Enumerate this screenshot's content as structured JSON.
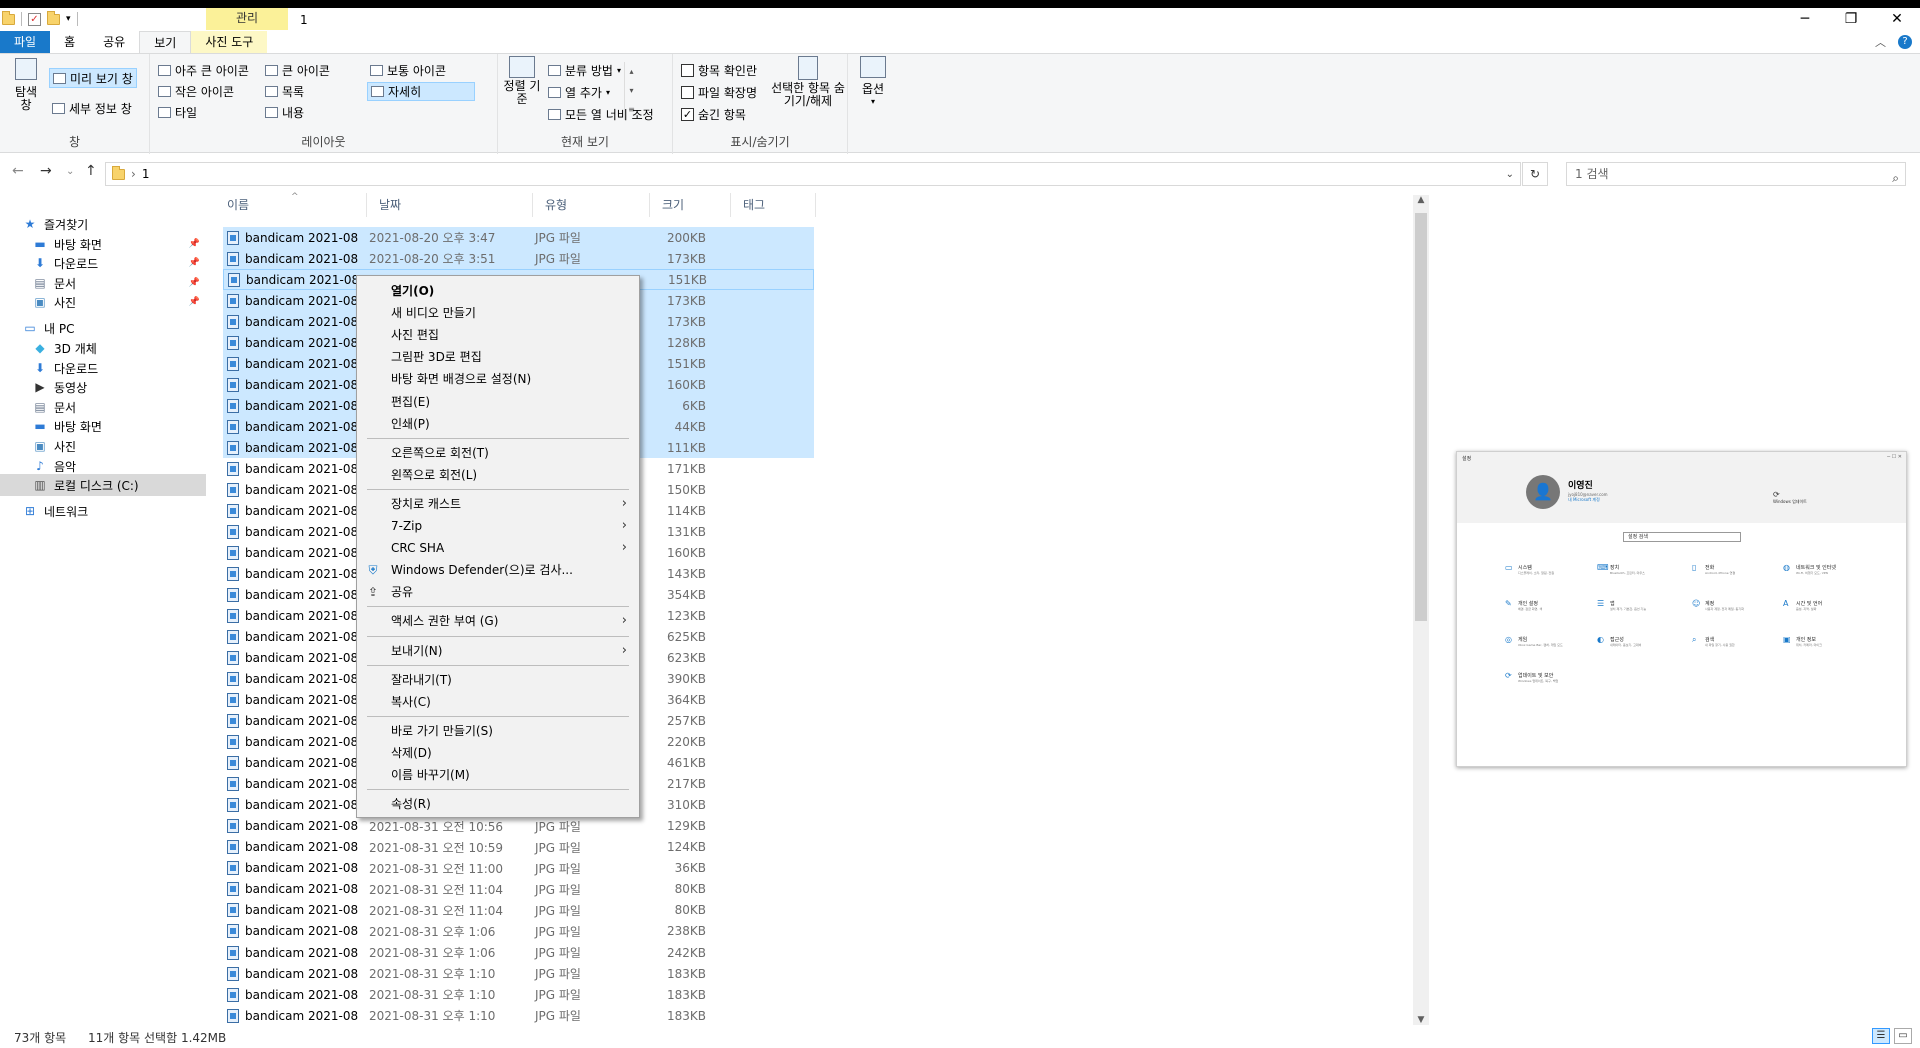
{
  "window": {
    "title": "1",
    "context_tab_header": "관리"
  },
  "ribbon_tabs": [
    {
      "label": "파일"
    },
    {
      "label": "홈"
    },
    {
      "label": "공유"
    },
    {
      "label": "보기"
    },
    {
      "label": "사진 도구"
    }
  ],
  "ribbon": {
    "pane_group": {
      "nav_pane": "탐색 창",
      "preview_pane": "미리 보기 창",
      "details_pane": "세부 정보 창",
      "label": "창"
    },
    "layout_group": {
      "items": [
        "아주 큰 아이콘",
        "큰 아이콘",
        "보통 아이콘",
        "작은 아이콘",
        "목록",
        "자세히",
        "타일",
        "내용"
      ],
      "label": "레이아웃"
    },
    "current_view_group": {
      "sort_by": "정렬 기준",
      "group_by": "분류 방법",
      "add_columns": "열 추가",
      "size_all_columns": "모든 열 너비 조정",
      "label": "현재 보기"
    },
    "show_hide_group": {
      "item_check_boxes": "항목 확인란",
      "file_extensions": "파일 확장명",
      "hidden_items": "숨긴 항목",
      "hide_selected": "선택한 항목 숨기기/해제",
      "label": "표시/숨기기",
      "checks": [
        false,
        false,
        true
      ]
    },
    "options": "옵션"
  },
  "address": {
    "path": "1",
    "search_placeholder": "1 검색"
  },
  "nav_pane": [
    {
      "label": "즐겨찾기",
      "icon": "star-icon",
      "level": 0
    },
    {
      "label": "바탕 화면",
      "icon": "desktop-icon",
      "level": 1,
      "pinned": true
    },
    {
      "label": "다운로드",
      "icon": "download-icon",
      "level": 1,
      "pinned": true
    },
    {
      "label": "문서",
      "icon": "document-icon",
      "level": 1,
      "pinned": true
    },
    {
      "label": "사진",
      "icon": "pictures-icon",
      "level": 1,
      "pinned": true
    },
    {
      "label": "내 PC",
      "icon": "pc-icon",
      "level": 0
    },
    {
      "label": "3D 개체",
      "icon": "cube-icon",
      "level": 1
    },
    {
      "label": "다운로드",
      "icon": "download-icon",
      "level": 1
    },
    {
      "label": "동영상",
      "icon": "video-icon",
      "level": 1
    },
    {
      "label": "문서",
      "icon": "document-icon",
      "level": 1
    },
    {
      "label": "바탕 화면",
      "icon": "desktop-icon",
      "level": 1
    },
    {
      "label": "사진",
      "icon": "pictures-icon",
      "level": 1
    },
    {
      "label": "음악",
      "icon": "music-icon",
      "level": 1
    },
    {
      "label": "로컬 디스크 (C:)",
      "icon": "drive-icon",
      "level": 1,
      "selected": true
    },
    {
      "label": "네트워크",
      "icon": "network-icon",
      "level": 0
    }
  ],
  "columns": {
    "name": "이름",
    "date": "날짜",
    "type": "유형",
    "size": "크기",
    "tags": "태그"
  },
  "files": [
    {
      "name": "bandicam 2021-08...",
      "date": "2021-08-20 오후 3:47",
      "type": "JPG 파일",
      "size": "200KB",
      "selected": true
    },
    {
      "name": "bandicam 2021-08...",
      "date": "2021-08-20 오후 3:51",
      "type": "JPG 파일",
      "size": "173KB",
      "selected": true
    },
    {
      "name": "bandicam 2021-08...",
      "date": "",
      "type": "",
      "size": "151KB",
      "selected": true,
      "focus": true
    },
    {
      "name": "bandicam 2021-08...",
      "date": "",
      "type": "",
      "size": "173KB",
      "selected": true
    },
    {
      "name": "bandicam 2021-08...",
      "date": "",
      "type": "",
      "size": "173KB",
      "selected": true
    },
    {
      "name": "bandicam 2021-08...",
      "date": "",
      "type": "",
      "size": "128KB",
      "selected": true
    },
    {
      "name": "bandicam 2021-08...",
      "date": "",
      "type": "",
      "size": "151KB",
      "selected": true
    },
    {
      "name": "bandicam 2021-08...",
      "date": "",
      "type": "",
      "size": "160KB",
      "selected": true
    },
    {
      "name": "bandicam 2021-08...",
      "date": "",
      "type": "",
      "size": "6KB",
      "selected": true
    },
    {
      "name": "bandicam 2021-08...",
      "date": "",
      "type": "",
      "size": "44KB",
      "selected": true
    },
    {
      "name": "bandicam 2021-08...",
      "date": "",
      "type": "",
      "size": "111KB",
      "selected": true
    },
    {
      "name": "bandicam 2021-08...",
      "date": "",
      "type": "",
      "size": "171KB"
    },
    {
      "name": "bandicam 2021-08...",
      "date": "",
      "type": "",
      "size": "150KB"
    },
    {
      "name": "bandicam 2021-08...",
      "date": "",
      "type": "",
      "size": "114KB"
    },
    {
      "name": "bandicam 2021-08...",
      "date": "",
      "type": "",
      "size": "131KB"
    },
    {
      "name": "bandicam 2021-08...",
      "date": "",
      "type": "",
      "size": "160KB"
    },
    {
      "name": "bandicam 2021-08...",
      "date": "",
      "type": "",
      "size": "143KB"
    },
    {
      "name": "bandicam 2021-08...",
      "date": "",
      "type": "",
      "size": "354KB"
    },
    {
      "name": "bandicam 2021-08...",
      "date": "",
      "type": "",
      "size": "123KB"
    },
    {
      "name": "bandicam 2021-08...",
      "date": "",
      "type": "",
      "size": "625KB"
    },
    {
      "name": "bandicam 2021-08...",
      "date": "",
      "type": "",
      "size": "623KB"
    },
    {
      "name": "bandicam 2021-08...",
      "date": "",
      "type": "",
      "size": "390KB"
    },
    {
      "name": "bandicam 2021-08...",
      "date": "",
      "type": "",
      "size": "364KB"
    },
    {
      "name": "bandicam 2021-08...",
      "date": "",
      "type": "",
      "size": "257KB"
    },
    {
      "name": "bandicam 2021-08...",
      "date": "",
      "type": "",
      "size": "220KB"
    },
    {
      "name": "bandicam 2021-08...",
      "date": "",
      "type": "",
      "size": "461KB"
    },
    {
      "name": "bandicam 2021-08...",
      "date": "",
      "type": "",
      "size": "217KB"
    },
    {
      "name": "bandicam 2021-08...",
      "date": "",
      "type": "",
      "size": "310KB"
    },
    {
      "name": "bandicam 2021-08...",
      "date": "2021-08-31 오전 10:56",
      "type": "JPG 파일",
      "size": "129KB"
    },
    {
      "name": "bandicam 2021-08...",
      "date": "2021-08-31 오전 10:59",
      "type": "JPG 파일",
      "size": "124KB"
    },
    {
      "name": "bandicam 2021-08...",
      "date": "2021-08-31 오전 11:00",
      "type": "JPG 파일",
      "size": "36KB"
    },
    {
      "name": "bandicam 2021-08...",
      "date": "2021-08-31 오전 11:04",
      "type": "JPG 파일",
      "size": "80KB"
    },
    {
      "name": "bandicam 2021-08...",
      "date": "2021-08-31 오전 11:04",
      "type": "JPG 파일",
      "size": "80KB"
    },
    {
      "name": "bandicam 2021-08...",
      "date": "2021-08-31 오후 1:06",
      "type": "JPG 파일",
      "size": "238KB"
    },
    {
      "name": "bandicam 2021-08...",
      "date": "2021-08-31 오후 1:06",
      "type": "JPG 파일",
      "size": "242KB"
    },
    {
      "name": "bandicam 2021-08...",
      "date": "2021-08-31 오후 1:10",
      "type": "JPG 파일",
      "size": "183KB"
    },
    {
      "name": "bandicam 2021-08...",
      "date": "2021-08-31 오후 1:10",
      "type": "JPG 파일",
      "size": "183KB"
    },
    {
      "name": "bandicam 2021-08...",
      "date": "2021-08-31 오후 1:10",
      "type": "JPG 파일",
      "size": "183KB"
    }
  ],
  "context_menu": [
    {
      "label": "열기(O)",
      "bold": true
    },
    {
      "label": "새 비디오 만들기"
    },
    {
      "label": "사진 편집"
    },
    {
      "label": "그림판 3D로 편집"
    },
    {
      "label": "바탕 화면 배경으로 설정(N)"
    },
    {
      "label": "편집(E)"
    },
    {
      "label": "인쇄(P)"
    },
    {
      "sep": true
    },
    {
      "label": "오른쪽으로 회전(T)"
    },
    {
      "label": "왼쪽으로 회전(L)"
    },
    {
      "sep": true
    },
    {
      "label": "장치로 캐스트",
      "submenu": true
    },
    {
      "label": "7-Zip",
      "submenu": true
    },
    {
      "label": "CRC SHA",
      "submenu": true
    },
    {
      "label": "Windows Defender(으)로 검사...",
      "icon": "defender-icon"
    },
    {
      "label": "공유",
      "icon": "share-icon"
    },
    {
      "sep": true
    },
    {
      "label": "액세스 권한 부여 (G)",
      "submenu": true
    },
    {
      "sep": true
    },
    {
      "label": "보내기(N)",
      "submenu": true
    },
    {
      "sep": true
    },
    {
      "label": "잘라내기(T)"
    },
    {
      "label": "복사(C)"
    },
    {
      "sep": true
    },
    {
      "label": "바로 가기 만들기(S)"
    },
    {
      "label": "삭제(D)"
    },
    {
      "label": "이름 바꾸기(M)"
    },
    {
      "sep": true
    },
    {
      "label": "속성(R)"
    }
  ],
  "preview": {
    "title": "설정",
    "user_name": "이영진",
    "email": "jyoj810@naver.com",
    "account_link": "내 Microsoft 계정",
    "windows_update": "Windows 업데이트",
    "search": "설정 검색",
    "items": [
      {
        "label": "시스템",
        "desc": "디스플레이, 소리, 알림, 전원",
        "icon": "system-icon"
      },
      {
        "label": "장치",
        "desc": "Bluetooth, 프린터, 마우스",
        "icon": "devices-icon"
      },
      {
        "label": "전화",
        "desc": "Android, iPhone 연결",
        "icon": "phone-icon"
      },
      {
        "label": "네트워크 및 인터넷",
        "desc": "Wi-Fi, 비행기 모드, VPN",
        "icon": "globe-icon"
      },
      {
        "label": "개인 설정",
        "desc": "배경, 잠금 화면, 색",
        "icon": "personalize-icon"
      },
      {
        "label": "앱",
        "desc": "설치 제거, 기본값, 옵션 기능",
        "icon": "apps-icon"
      },
      {
        "label": "계정",
        "desc": "사용자 계정, 전자 메일, 동기화",
        "icon": "account-icon"
      },
      {
        "label": "시간 및 언어",
        "desc": "음성, 지역, 날짜",
        "icon": "time-icon"
      },
      {
        "label": "게임",
        "desc": "Xbox Game Bar, 캡처, 게임 모드",
        "icon": "game-icon"
      },
      {
        "label": "접근성",
        "desc": "내레이터, 돋보기, 고대비",
        "icon": "ease-icon"
      },
      {
        "label": "검색",
        "desc": "내 파일 찾기, 사용 권한",
        "icon": "search-icon"
      },
      {
        "label": "개인 정보",
        "desc": "위치, 카메라, 마이크",
        "icon": "lock-icon"
      },
      {
        "label": "업데이트 및 보안",
        "desc": "Windows 업데이트, 복구, 백업",
        "icon": "update-icon"
      }
    ]
  },
  "status": {
    "count": "73개 항목",
    "selection": "11개 항목 선택함 1.42MB"
  },
  "colors": {
    "accent": "#1979ca",
    "selection": "#cce8ff",
    "context_tab": "#fbf199"
  }
}
